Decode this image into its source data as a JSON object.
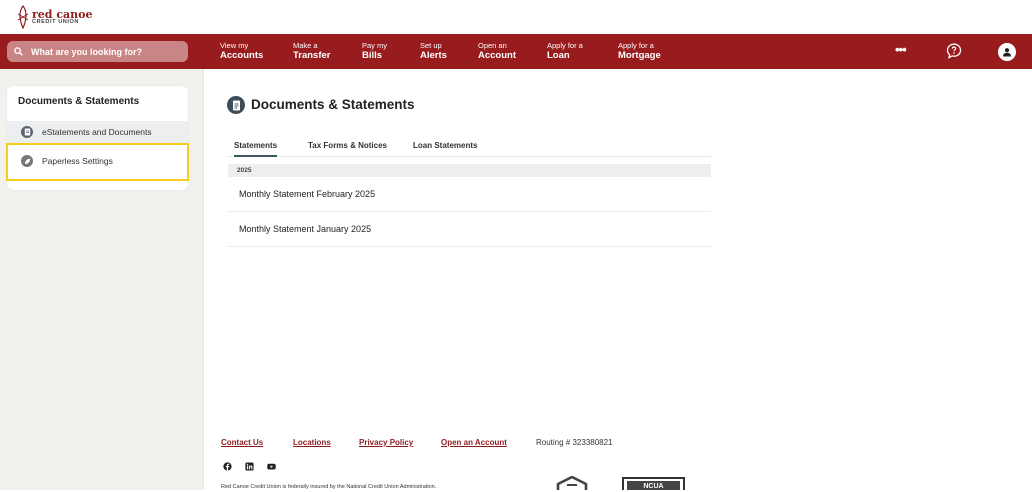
{
  "brand": {
    "name": "red canoe",
    "sub": "CREDIT UNION"
  },
  "search": {
    "placeholder": "What are you looking for?"
  },
  "nav": [
    {
      "small": "View my",
      "big": "Accounts"
    },
    {
      "small": "Make a",
      "big": "Transfer"
    },
    {
      "small": "Pay my",
      "big": "Bills"
    },
    {
      "small": "Set up",
      "big": "Alerts"
    },
    {
      "small": "Open an",
      "big": "Account"
    },
    {
      "small": "Apply for a",
      "big": "Loan"
    },
    {
      "small": "Apply for a",
      "big": "Mortgage"
    }
  ],
  "nav_more": "•••",
  "sidebar": {
    "title": "Documents & Statements",
    "items": [
      {
        "label": "eStatements and Documents"
      },
      {
        "label": "Paperless Settings"
      }
    ]
  },
  "page": {
    "title": "Documents & Statements",
    "tabs": [
      {
        "label": "Statements"
      },
      {
        "label": "Tax Forms & Notices"
      },
      {
        "label": "Loan Statements"
      }
    ],
    "year": "2025",
    "statements": [
      {
        "label": "Monthly Statement February 2025"
      },
      {
        "label": "Monthly Statement January 2025"
      }
    ]
  },
  "footer": {
    "links": [
      {
        "label": "Contact Us"
      },
      {
        "label": "Locations"
      },
      {
        "label": "Privacy Policy"
      },
      {
        "label": "Open an Account"
      }
    ],
    "routing": "Routing # 323380821",
    "insured": "Red Canoe Credit Union is federally insured by the National Credit Union Administration.",
    "ncua": "NCUA"
  },
  "colors": {
    "nav_bg": "#981b1e",
    "brand": "#8e1c1f",
    "highlight": "#f5cd1b",
    "tab_underline": "#3e5563"
  }
}
